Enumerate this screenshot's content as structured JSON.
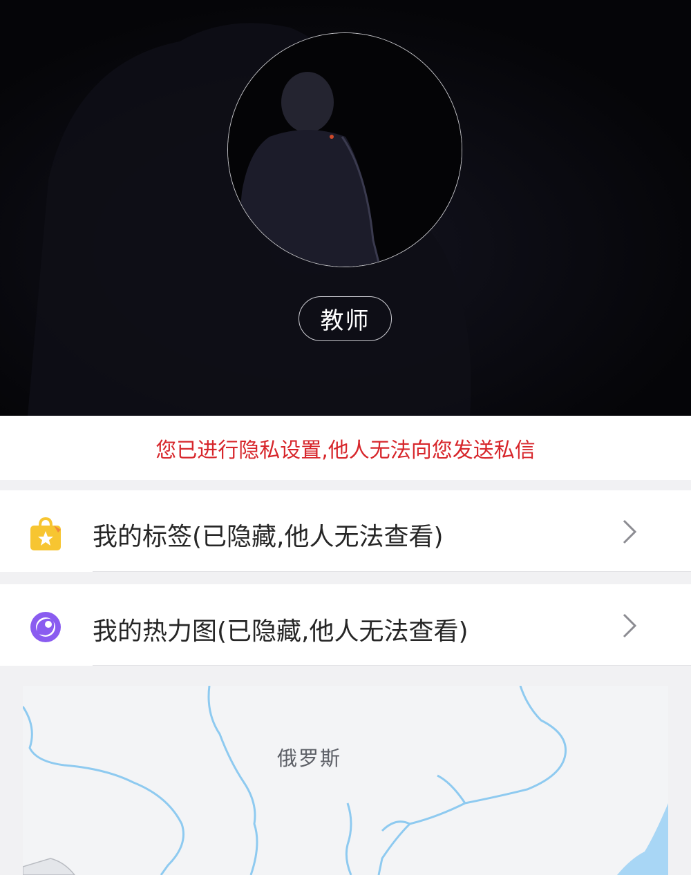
{
  "profile": {
    "role_badge": "教师"
  },
  "privacy_notice": "您已进行隐私设置,他人无法向您发送私信",
  "menu": {
    "items": [
      {
        "label": "我的标签(已隐藏,他人无法查看)",
        "icon": "tag-bag-icon",
        "icon_color": "#f7c531"
      },
      {
        "label": "我的热力图(已隐藏,他人无法查看)",
        "icon": "heatmap-icon",
        "icon_color": "#8a5cf0"
      }
    ]
  },
  "map": {
    "region_label": "俄罗斯",
    "river_color": "#8ecaf0"
  },
  "colors": {
    "notice_text": "#d7262b",
    "hero_background": "#050508"
  }
}
